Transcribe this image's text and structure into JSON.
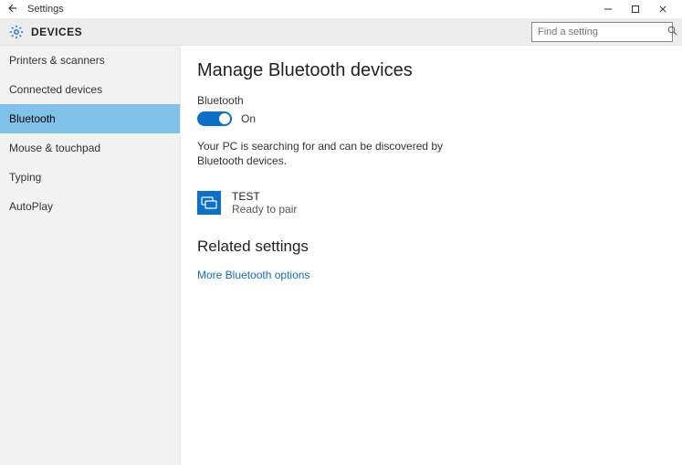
{
  "titlebar": {
    "app_name": "Settings"
  },
  "header": {
    "title": "DEVICES",
    "search_placeholder": "Find a setting"
  },
  "sidebar": {
    "items": [
      {
        "label": "Printers & scanners",
        "active": false
      },
      {
        "label": "Connected devices",
        "active": false
      },
      {
        "label": "Bluetooth",
        "active": true
      },
      {
        "label": "Mouse & touchpad",
        "active": false
      },
      {
        "label": "Typing",
        "active": false
      },
      {
        "label": "AutoPlay",
        "active": false
      }
    ]
  },
  "main": {
    "page_title": "Manage Bluetooth devices",
    "toggle_label": "Bluetooth",
    "toggle_state": "On",
    "status_text": "Your PC is searching for and can be discovered by Bluetooth devices.",
    "device": {
      "name": "TEST",
      "status": "Ready to pair"
    },
    "related_title": "Related settings",
    "related_link": "More Bluetooth options"
  }
}
